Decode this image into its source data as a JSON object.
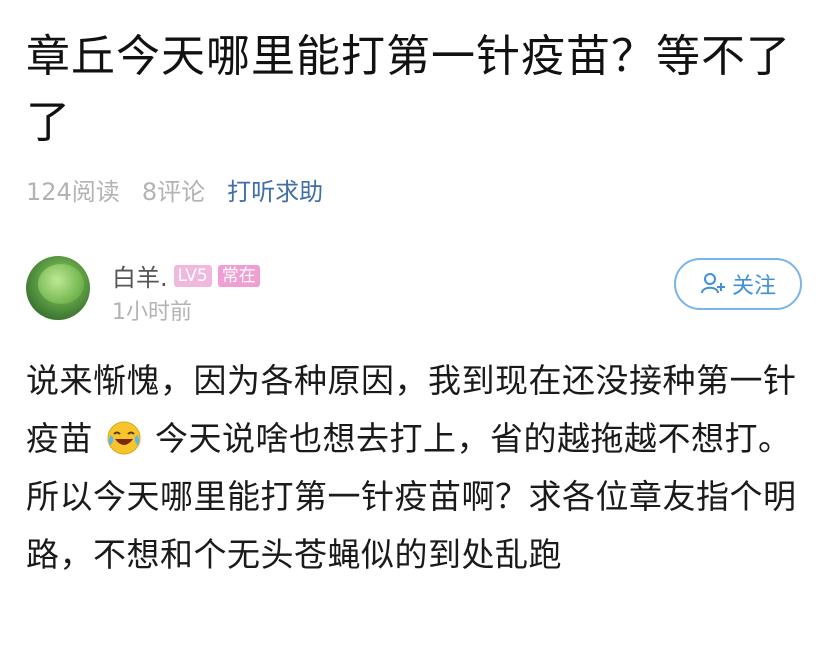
{
  "post": {
    "title": "章丘今天哪里能打第一针疫苗？等不了了",
    "reads": "124阅读",
    "comments": "8评论",
    "topic": "打听求助"
  },
  "author": {
    "name": "白羊.",
    "level": "LV5",
    "badge": "常在",
    "time": "1小时前"
  },
  "follow": {
    "label": "关注",
    "icon": "add-user-icon"
  },
  "content": {
    "part1": "说来惭愧，因为各种原因，我到现在还没接种第一针疫苗",
    "emoji": "laughing-tears-emoji",
    "part2": "今天说啥也想去打上，省的越拖越不想打。所以今天哪里能打第一针疫苗啊？求各位章友指个明路，不想和个无头苍蝇似的到处乱跑"
  },
  "colors": {
    "topic": "#3f6ea8",
    "meta": "#b3b3b3",
    "follow_border": "#7ab4e8",
    "follow_text": "#3f8fd9",
    "badge_level": "#f0b8df",
    "badge_regular": "#ef9fd4"
  }
}
